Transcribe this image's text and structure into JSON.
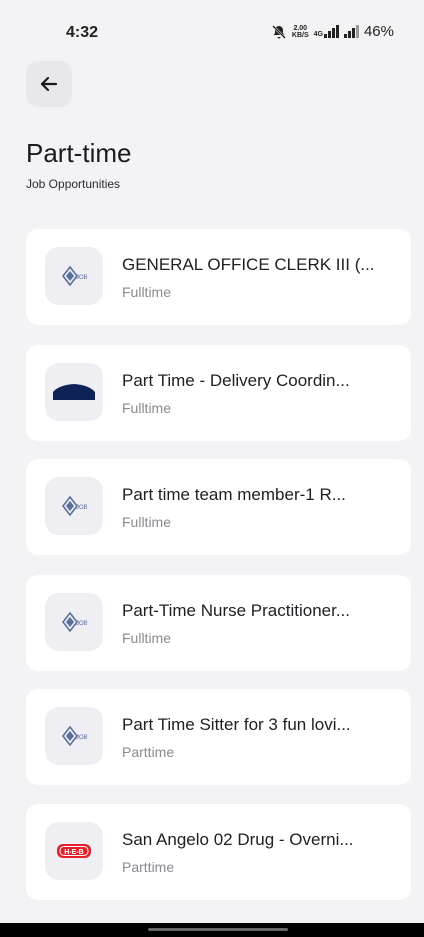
{
  "status_bar": {
    "time": "4:32",
    "net_speed_top": "2.00",
    "net_speed_bottom": "KB/S",
    "network_type": "4G",
    "battery": "46%"
  },
  "header": {
    "title": "Part-time",
    "subtitle": "Job Opportunities"
  },
  "jobs": [
    {
      "title": "GENERAL OFFICE CLERK III (...",
      "type": "Fulltime",
      "logo": "job-logo"
    },
    {
      "title": "Part Time - Delivery Coordin...",
      "type": "Fulltime",
      "logo": "navy-awning-logo"
    },
    {
      "title": "Part time team member-1 R...",
      "type": "Fulltime",
      "logo": "job-logo"
    },
    {
      "title": "Part-Time Nurse Practitioner...",
      "type": "Fulltime",
      "logo": "job-logo"
    },
    {
      "title": "Part Time Sitter for 3 fun lovi...",
      "type": "Parttime",
      "logo": "job-logo"
    },
    {
      "title": "San Angelo 02 Drug - Overni...",
      "type": "Parttime",
      "logo": "heb-logo",
      "logo_text": "H-E-B"
    }
  ],
  "colors": {
    "background": "#f3f3f6",
    "card": "#ffffff",
    "logo_bg": "#eeeef3",
    "job_logo_blue": "#5a6f9a",
    "navy": "#0f2257",
    "heb_red": "#e3202b"
  }
}
